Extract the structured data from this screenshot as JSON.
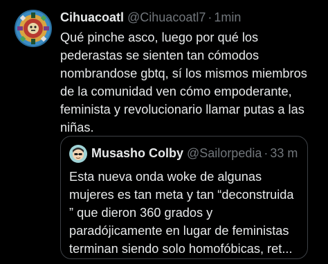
{
  "tweet": {
    "author": {
      "display_name": "Cihuacoatl",
      "handle": "@Cihuacoatl7",
      "avatar_icon": "aztec-calendar-avatar-icon"
    },
    "separator": "·",
    "time": "1min",
    "text": "Qué pinche asco, luego por qué los\npederastas se sienten tan cómodos\nnombrandose gbtq, sí los mismos miembros\nde la comunidad ven cómo empoderante,\nfeminista y revolucionario llamar putas a las\nniñas.",
    "quoted_tweet": {
      "author": {
        "display_name": "Musasho Colby",
        "handle": "@Sailorpedia",
        "avatar_icon": "cartoon-face-avatar-icon"
      },
      "separator": "·",
      "time": "33 m",
      "text": "Esta nueva onda woke de algunas\nmujeres es tan meta y tan “deconstruida\n” que dieron 360 grados y\nparadójicamente en lugar de feministas\nterminan siendo solo homofóbicas, ret..."
    }
  },
  "colors": {
    "background": "#000000",
    "primary_text": "#e7e9ea",
    "secondary_text": "#71767b",
    "border": "#3d4146"
  }
}
